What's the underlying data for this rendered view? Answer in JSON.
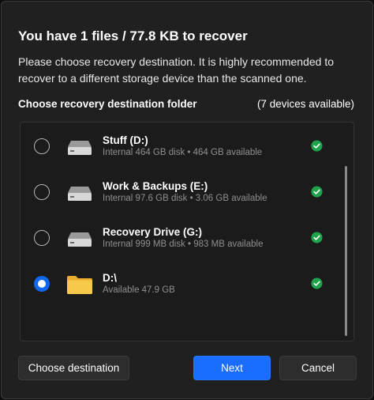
{
  "dialog": {
    "title": "You have 1 files / 77.8 KB to recover",
    "subtitle": "Please choose recovery destination. It is highly recommended to recover to a different storage device than the scanned one.",
    "section_label": "Choose recovery destination folder",
    "device_count": "(7 devices available)"
  },
  "devices": [
    {
      "name": "Stuff (D:)",
      "info": "Internal 464 GB disk • 464 GB available",
      "icon": "hard-drive-icon",
      "selected": false,
      "status": "ok"
    },
    {
      "name": "Work & Backups (E:)",
      "info": "Internal 97.6 GB disk • 3.06 GB available",
      "icon": "hard-drive-icon",
      "selected": false,
      "status": "ok"
    },
    {
      "name": "Recovery Drive (G:)",
      "info": "Internal 999 MB disk • 983 MB available",
      "icon": "hard-drive-icon",
      "selected": false,
      "status": "ok"
    },
    {
      "name": "D:\\",
      "info": "Available 47.9 GB",
      "icon": "folder-icon",
      "selected": true,
      "status": "ok"
    }
  ],
  "buttons": {
    "choose": "Choose destination",
    "next": "Next",
    "cancel": "Cancel"
  },
  "colors": {
    "accent": "#1a6dff",
    "ok": "#1fa34a",
    "folder": "#f5c542"
  }
}
